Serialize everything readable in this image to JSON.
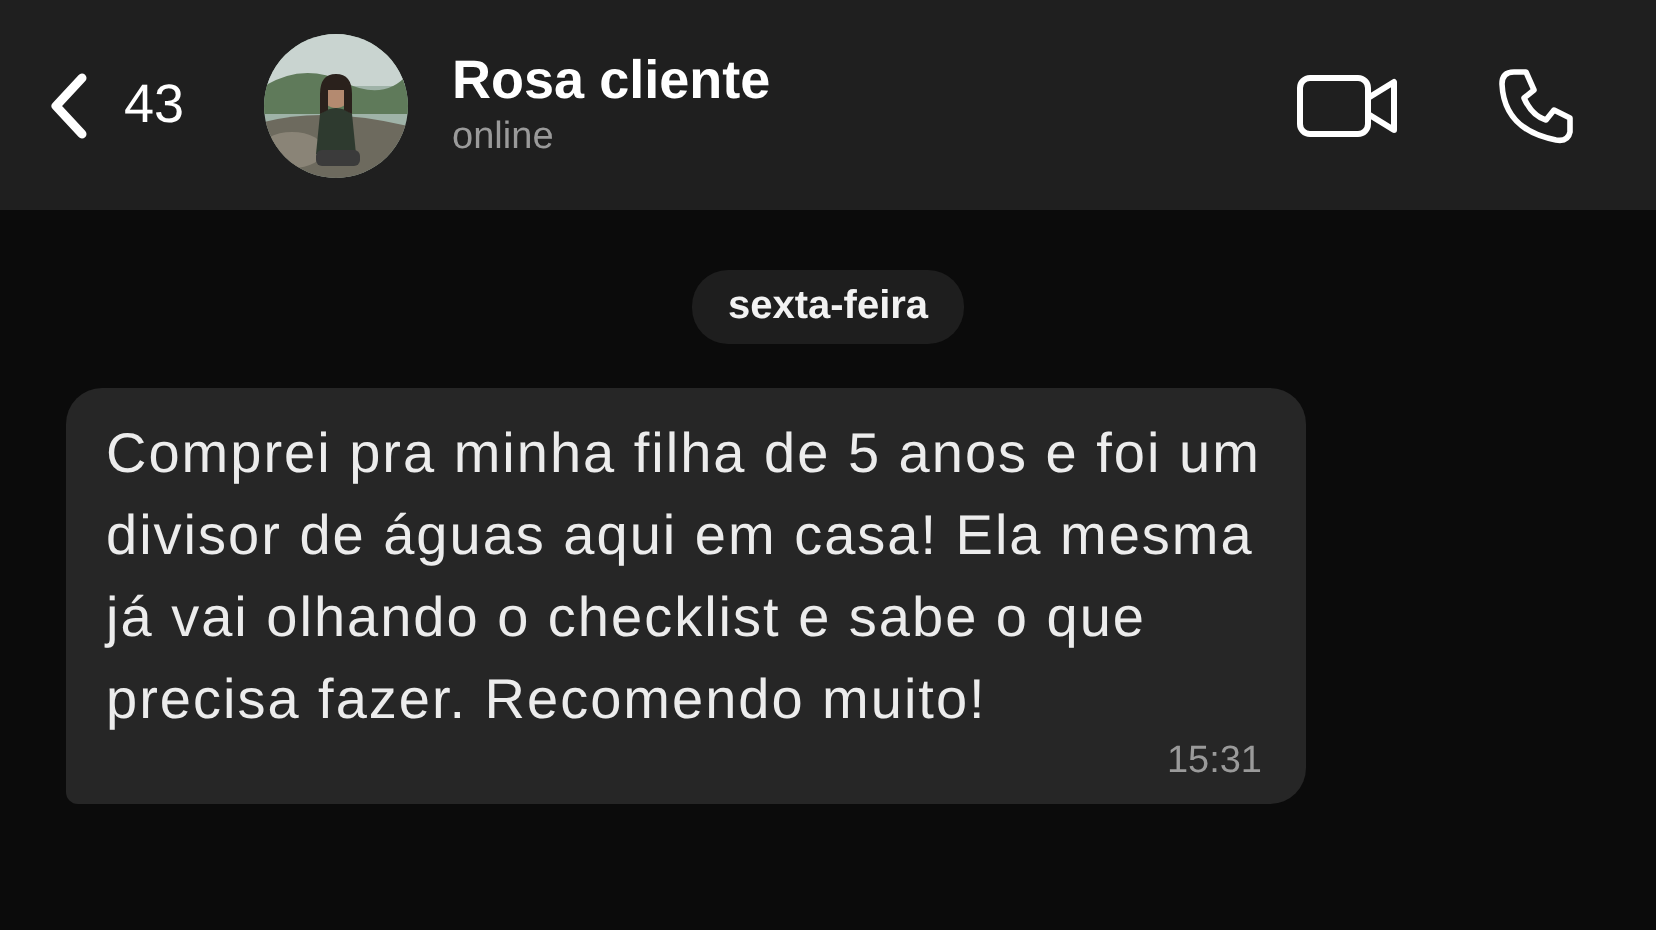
{
  "header": {
    "back_count": "43",
    "contact_name": "Rosa cliente",
    "status": "online"
  },
  "date_separator": "sexta-feira",
  "messages": [
    {
      "text": "Comprei pra minha filha de 5 anos e foi um divisor de águas aqui em casa! Ela mesma já vai olhando o checklist e sabe o que precisa fazer. Recomendo muito!",
      "time": "15:31"
    }
  ]
}
